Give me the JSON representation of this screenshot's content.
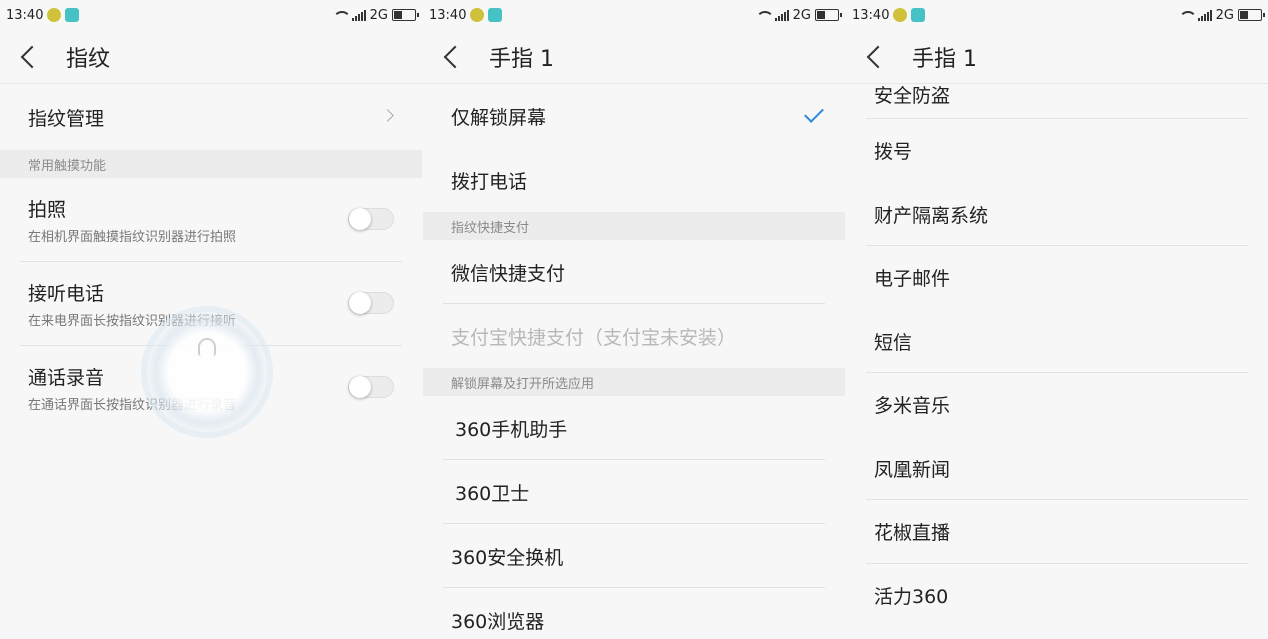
{
  "screens": [
    {
      "status": {
        "time": "13:40",
        "network": "2G"
      },
      "title": "指纹",
      "items": [
        {
          "label": "指纹管理"
        }
      ],
      "section": "常用触摸功能",
      "toggles": [
        {
          "title": "拍照",
          "subtitle": "在相机界面触摸指纹识别器进行拍照",
          "on": false
        },
        {
          "title": "接听电话",
          "subtitle": "在来电界面长按指纹识别器进行接听",
          "on": false
        },
        {
          "title": "通话录音",
          "subtitle": "在通话界面长按指纹识别器进行录音",
          "on": false
        }
      ]
    },
    {
      "status": {
        "time": "13:40",
        "network": "2G"
      },
      "title": "手指 1",
      "options": [
        "仅解锁屏幕",
        "拨打电话"
      ],
      "selected": "仅解锁屏幕",
      "section_pay": "指纹快捷支付",
      "pay": [
        "微信快捷支付",
        "支付宝快捷支付（支付宝未安装）"
      ],
      "section_apps": "解锁屏幕及打开所选应用",
      "apps": [
        "360手机助手",
        "360卫士",
        "360安全换机",
        "360浏览器"
      ]
    },
    {
      "status": {
        "time": "13:40",
        "network": "2G"
      },
      "title": "手指 1",
      "apps": [
        "安全防盗",
        "拨号",
        "财产隔离系统",
        "电子邮件",
        "短信",
        "多米音乐",
        "凤凰新闻",
        "花椒直播",
        "活力360"
      ]
    }
  ],
  "colors": {
    "accent": "#2b8ae0",
    "section_bg": "#ececec",
    "page_bg": "#f7f7f7"
  },
  "icons": [
    "back-arrow-icon",
    "chevron-right-icon",
    "checkmark-icon",
    "bell-icon",
    "wifi-icon",
    "signal-icon",
    "battery-icon"
  ]
}
